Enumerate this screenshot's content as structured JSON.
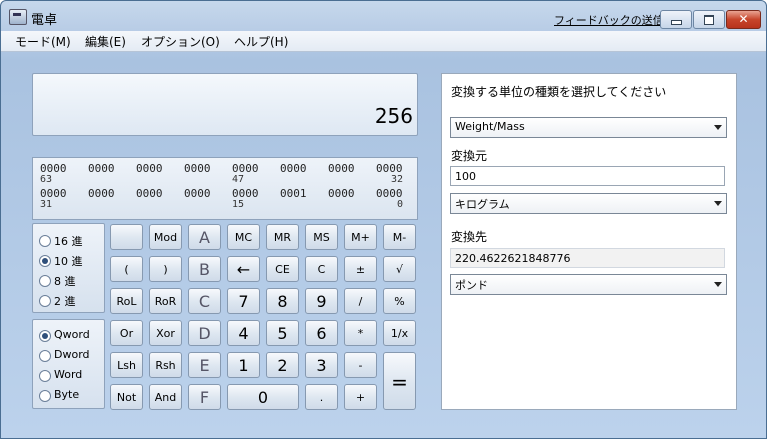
{
  "window": {
    "title": "電卓",
    "feedback_link": "フィードバックの送信",
    "close_glyph": "✕"
  },
  "menu": [
    "モード(M)",
    "編集(E)",
    "オプション(O)",
    "ヘルプ(H)"
  ],
  "display": {
    "value": "256"
  },
  "bits": {
    "row1": [
      "0000",
      "0000",
      "0000",
      "0000",
      "0000",
      "0000",
      "0000",
      "0000"
    ],
    "row1_idx": [
      "63",
      "47",
      "32"
    ],
    "row2": [
      "0000",
      "0000",
      "0000",
      "0000",
      "0000",
      "0001",
      "0000",
      "0000"
    ],
    "row2_idx": [
      "31",
      "15",
      "0"
    ]
  },
  "base_options": [
    {
      "label": "16 進",
      "selected": false
    },
    {
      "label": "10 進",
      "selected": true
    },
    {
      "label": "8 進",
      "selected": false
    },
    {
      "label": "2 進",
      "selected": false
    }
  ],
  "word_options": [
    {
      "label": "Qword",
      "selected": true
    },
    {
      "label": "Dword",
      "selected": false
    },
    {
      "label": "Word",
      "selected": false
    },
    {
      "label": "Byte",
      "selected": false
    }
  ],
  "keys": {
    "row1": [
      "",
      "Mod",
      "A",
      "MC",
      "MR",
      "MS",
      "M+",
      "M-"
    ],
    "row2": [
      "(",
      ")",
      "B",
      "←",
      "CE",
      "C",
      "±",
      "√"
    ],
    "row3": [
      "RoL",
      "RoR",
      "C",
      "7",
      "8",
      "9",
      "/",
      "%"
    ],
    "row4": [
      "Or",
      "Xor",
      "D",
      "4",
      "5",
      "6",
      "*",
      "1/x"
    ],
    "row5": [
      "Lsh",
      "Rsh",
      "E",
      "1",
      "2",
      "3",
      "-"
    ],
    "row6": [
      "Not",
      "And",
      "F",
      "0",
      ".",
      "+"
    ],
    "equals": "="
  },
  "converter": {
    "prompt": "変換する単位の種類を選択してください",
    "category": "Weight/Mass",
    "from_label": "変換元",
    "from_value": "100",
    "from_unit": "キログラム",
    "to_label": "変換先",
    "to_value": "220.4622621848776",
    "to_unit": "ポンド"
  }
}
